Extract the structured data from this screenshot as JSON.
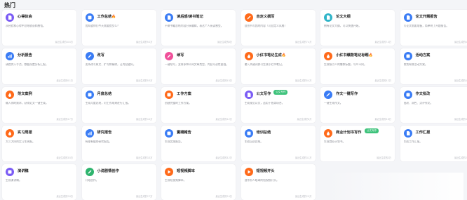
{
  "section": {
    "title": "热门"
  },
  "colors": {
    "purple": "#7b5cf5",
    "blue": "#3a7cf5",
    "pink": "#f0509a",
    "orange": "#ff6a1a",
    "green": "#2fb46e",
    "gray": "#8a8d96",
    "badge": "#3cc27a"
  },
  "cards": [
    {
      "title": "心得体会",
      "fire": false,
      "badge": "",
      "icon": "document-icon",
      "color": "#7b5cf5",
      "desc": "从经验和心得中总结收获和感悟。",
      "meta": "最近生成的10.6万"
    },
    {
      "title": "工作总结",
      "fire": true,
      "badge": "",
      "icon": "briefcase-icon",
      "color": "#3a7cf5",
      "desc": "我知道你们今天需要提交么？",
      "meta": "最近生成的9.2万"
    },
    {
      "title": "读后感/读书笔记",
      "fire": false,
      "badge": "",
      "icon": "book-icon",
      "color": "#3a7cf5",
      "desc": "不做书籍总结内容分享编辑，表达个人阅读感受。",
      "meta": "最近生成的8万"
    },
    {
      "title": "自定义撰写",
      "fire": false,
      "badge": "",
      "icon": "pen-icon",
      "color": "#ff6a1a",
      "desc": "自由书写我的内容（可自定义风格）",
      "meta": "最近生成的7.4万"
    },
    {
      "title": "论文大纲",
      "fire": false,
      "badge": "",
      "icon": "outline-icon",
      "color": "#2fb4c8",
      "desc": "拥有论文大纲，可以快速开始。",
      "meta": "最近生成的7.3万"
    },
    {
      "title": "论文开题报告",
      "fire": false,
      "badge": "",
      "icon": "report-icon",
      "color": "#3a7cf5",
      "desc": "写论文前要准备，简单明了开题报告。",
      "meta": "最近生成的6.9万"
    },
    {
      "title": "分析报告",
      "fire": false,
      "badge": "",
      "icon": "chart-icon",
      "color": "#3a7cf5",
      "desc": "请提供入手点，数据深度分析汇报。",
      "meta": "最近生成的6.1万"
    },
    {
      "title": "改写",
      "fire": false,
      "badge": "",
      "icon": "edit-icon",
      "color": "#3a7cf5",
      "desc": "支持改写原文、扩写和精修，让内容更好。",
      "meta": "最近生成的5.9万"
    },
    {
      "title": "续写",
      "fire": false,
      "badge": "",
      "icon": "continue-icon",
      "color": "#f0509a",
      "desc": "一键续写，支持多种不同文章类型，内容可读性更强。",
      "meta": "最近生成的5.5万"
    },
    {
      "title": "小红书笔记生成",
      "fire": true,
      "badge": "",
      "icon": "xiaohongshu-icon",
      "color": "#ff6a1a",
      "desc": "输入关键词即可生成小红书笔记。",
      "meta": "最近生成的5.4万"
    },
    {
      "title": "小红书爆款笔记标题",
      "fire": true,
      "badge": "",
      "icon": "xiaohongshu-icon",
      "color": "#ff6a1a",
      "desc": "生成吸引人的爆款标题，与众不同。",
      "meta": "最近生成的5.2万"
    },
    {
      "title": "活动方案",
      "fire": false,
      "badge": "",
      "icon": "event-icon",
      "color": "#3a7cf5",
      "desc": "策划有效活动方案。",
      "meta": "最近生成的4.9万"
    },
    {
      "title": "范文案例",
      "fire": false,
      "badge": "",
      "icon": "sample-icon",
      "color": "#ff6a1a",
      "desc": "输入你的需求，获得范文一键生成。",
      "meta": "最近生成的4.7万"
    },
    {
      "title": "月度总结",
      "fire": false,
      "badge": "",
      "icon": "calendar-icon",
      "color": "#3a7cf5",
      "desc": "生成月度总结，对工作成果进行汇报。",
      "meta": "最近生成的4.4万"
    },
    {
      "title": "工作方案",
      "fire": false,
      "badge": "",
      "icon": "plan-icon",
      "color": "#ff6a1a",
      "desc": "创建完整的工作方案。",
      "meta": "最近生成的4.2万"
    },
    {
      "title": "公文写作",
      "fire": false,
      "badge": "公文写作",
      "icon": "official-icon",
      "color": "#7b5cf5",
      "desc": "生成规范公文，适用于各类场合。",
      "meta": "最近生成的4万"
    },
    {
      "title": "作文一键写作",
      "fire": false,
      "badge": "",
      "icon": "essay-icon",
      "color": "#3a7cf5",
      "desc": "一键生成作文。",
      "meta": "最近生成的3.8万"
    },
    {
      "title": "作文批改",
      "fire": false,
      "badge": "",
      "icon": "check-icon",
      "color": "#3a7cf5",
      "desc": "批改、润色、点评作文。",
      "meta": "最近生成的3.7万"
    },
    {
      "title": "实习周报",
      "fire": false,
      "badge": "",
      "icon": "weekly-icon",
      "color": "#ff6a1a",
      "desc": "大三大四的实习生周报。",
      "meta": "最近生成的3.5万"
    },
    {
      "title": "研究报告",
      "fire": false,
      "badge": "",
      "icon": "research-icon",
      "color": "#3a7cf5",
      "desc": "有理有据的研究报告。",
      "meta": "最近生成的3.3万"
    },
    {
      "title": "實踐報告",
      "fire": false,
      "badge": "",
      "icon": "practice-icon",
      "color": "#3a7cf5",
      "desc": "生成实践报告。",
      "meta": "最近生成的3.2万"
    },
    {
      "title": "培训总结",
      "fire": false,
      "badge": "",
      "icon": "training-icon",
      "color": "#3a7cf5",
      "desc": "生成培训总结。",
      "meta": "最近生成的3.1万"
    },
    {
      "title": "商业计划书写作",
      "fire": false,
      "badge": "公文写作",
      "icon": "business-icon",
      "color": "#ff6a1a",
      "desc": "生成商业计划书。",
      "meta": "最近生成的3万"
    },
    {
      "title": "工作汇报",
      "fire": false,
      "badge": "",
      "icon": "report-icon",
      "color": "#3a7cf5",
      "desc": "生成工作汇报。",
      "meta": "最近生成的2.9万"
    },
    {
      "title": "演讲稿",
      "fire": false,
      "badge": "",
      "icon": "speech-icon",
      "color": "#7b5cf5",
      "desc": "生成演讲稿。",
      "meta": "最近生成的2.8万"
    },
    {
      "title": "小说剧情创作",
      "fire": false,
      "badge": "",
      "icon": "story-icon",
      "color": "#2fb46e",
      "desc": "开始创作。",
      "meta": "最近生成的2.7万"
    },
    {
      "title": "短视频脚本",
      "fire": false,
      "badge": "",
      "icon": "video-icon",
      "color": "#ff6a1a",
      "desc": "生成短视频脚本。",
      "meta": "最近生成的2.6万"
    },
    {
      "title": "短视频开头",
      "fire": false,
      "badge": "",
      "icon": "video-opener-icon",
      "color": "#ff6a1a",
      "desc": "创作抓人眼球的短视频开头。",
      "meta": "最近生成的2.5万"
    }
  ]
}
